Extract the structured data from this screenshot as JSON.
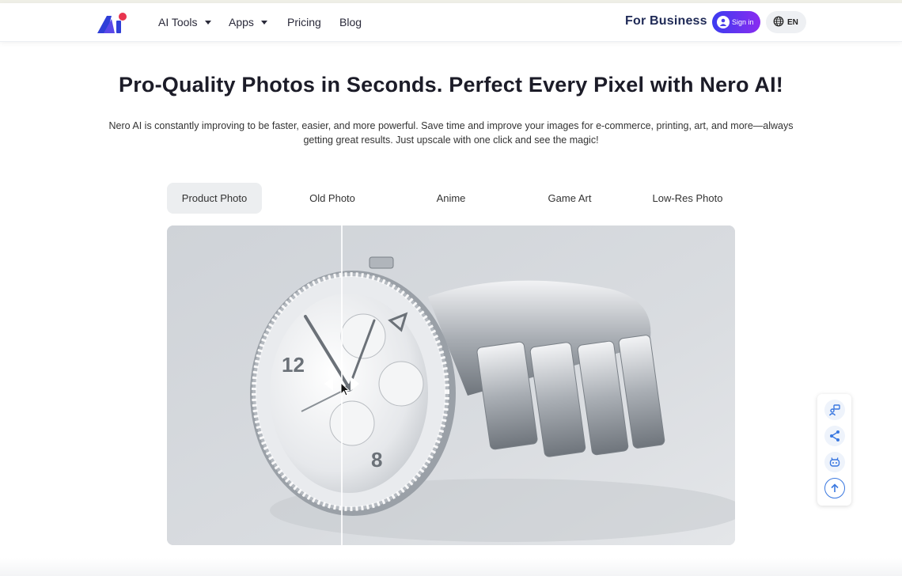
{
  "nav": {
    "items": [
      {
        "label": "AI Tools",
        "dropdown": true
      },
      {
        "label": "Apps",
        "dropdown": true
      },
      {
        "label": "Pricing",
        "dropdown": false
      },
      {
        "label": "Blog",
        "dropdown": false
      }
    ],
    "for_business": "For Business",
    "sign_in": "Sign in",
    "language": "EN"
  },
  "hero": {
    "headline": "Pro-Quality Photos in Seconds. Perfect Every Pixel with Nero AI!",
    "description": "Nero AI is constantly improving to be faster, easier, and more powerful. Save time and improve your images for e-commerce, printing, art, and more—always getting great results. Just upscale with one click and see the magic!"
  },
  "tabs": {
    "items": [
      "Product Photo",
      "Old Photo",
      "Anime",
      "Game Art",
      "Low-Res Photo"
    ],
    "active": "Product Photo"
  },
  "compare": {
    "subject": "wristwatch",
    "slider_position": 0.31
  },
  "floating_toolbar": [
    "feedback-icon",
    "share-icon",
    "robot-icon",
    "arrow-up-icon"
  ],
  "colors": {
    "brand_blue": "#2f3fd8",
    "brand_red": "#e8344e",
    "sign_in_gradient_start": "#3c3cf0",
    "sign_in_gradient_end": "#8a2cf0",
    "business_text": "#1f2a56",
    "accent_icon": "#3a78e0"
  }
}
